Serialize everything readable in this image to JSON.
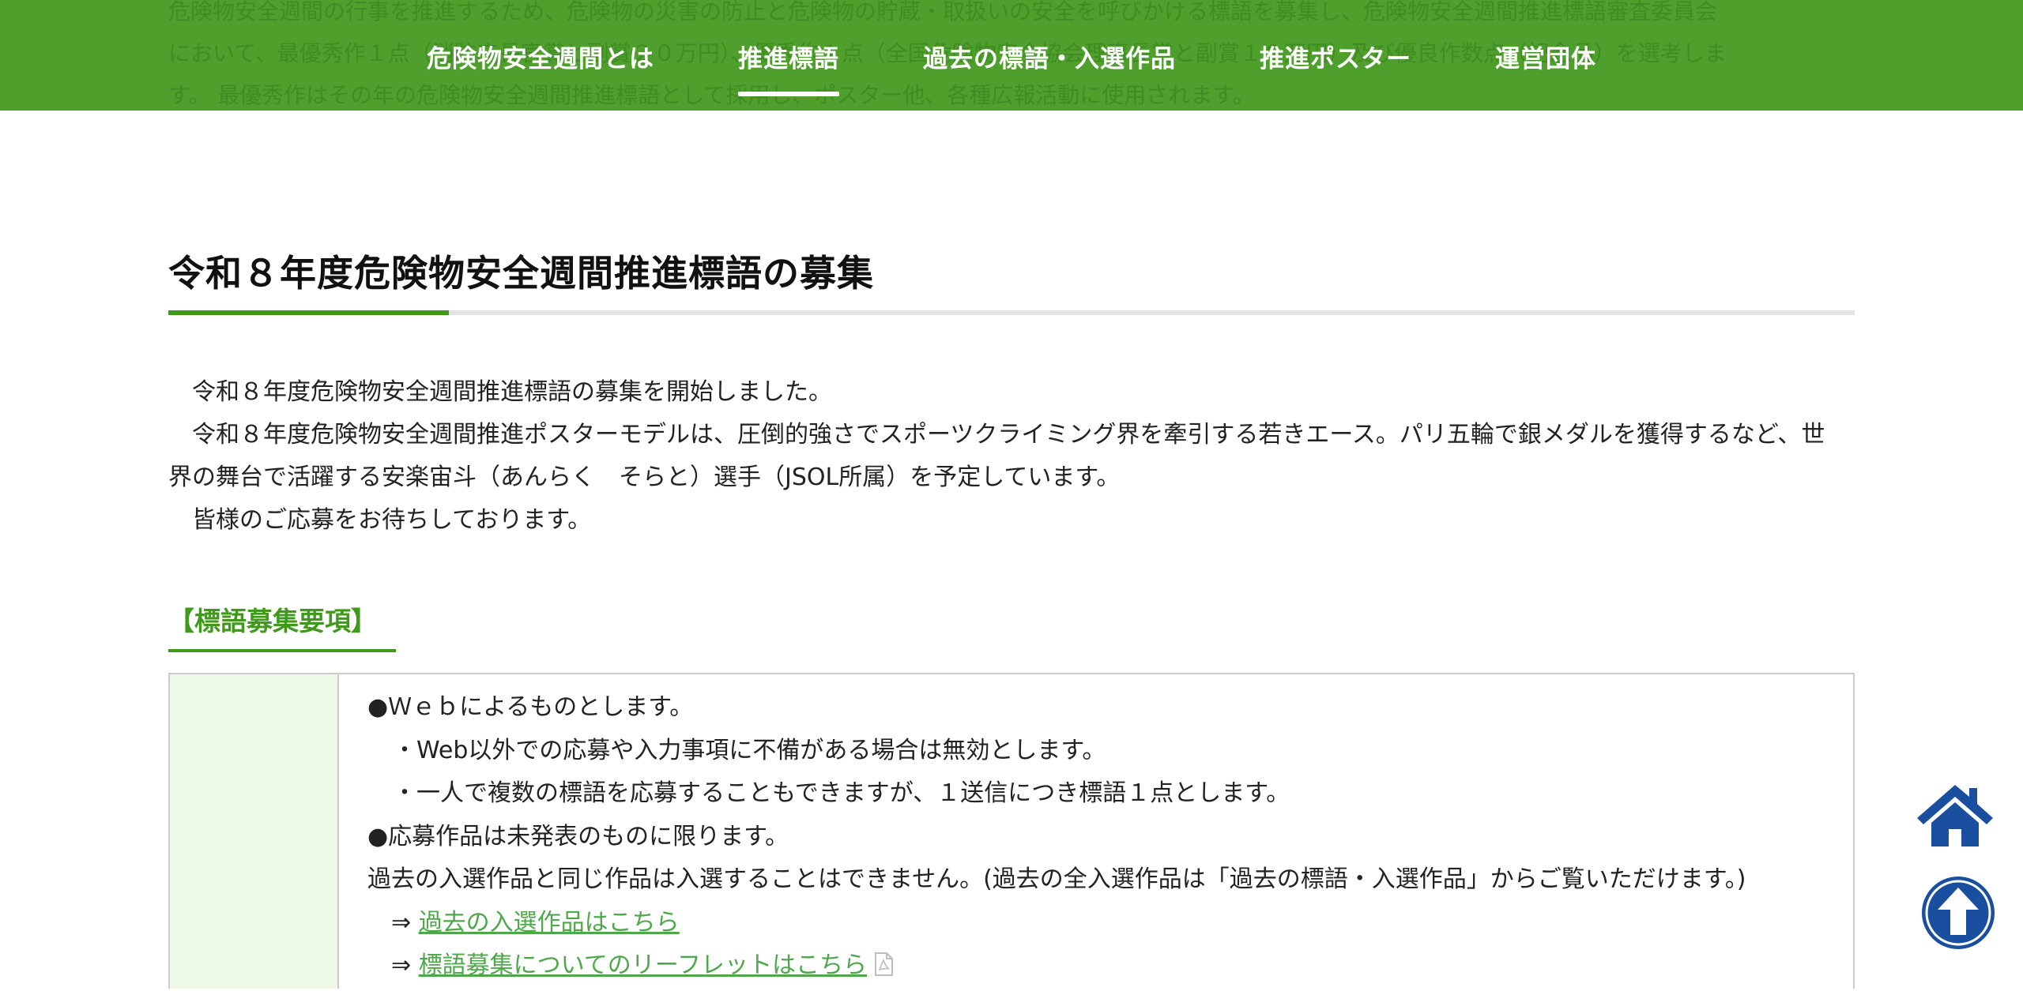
{
  "header": {
    "ghost_text": [
      "危険物安全週間の行事を推進するため、危険物の災害の防止と危険物の貯蔵・取扱いの安全を呼びかける標語を募集し、危険物安全週間推進標語審査委員会",
      "において、最優秀作１点（消防庁長官賞と副賞２０万円）、優秀作１点（全国危険物安全協会理事長賞と副賞１０万円）及び優良作数点（記念品）を選考しま",
      "す。 最優秀作はその年の危険物安全週間推進標語として採用し、ポスター他、各種広報活動に使用されます。"
    ],
    "nav": [
      {
        "label": "危険物安全週間とは",
        "active": false
      },
      {
        "label": "推進標語",
        "active": true
      },
      {
        "label": "過去の標語・入選作品",
        "active": false
      },
      {
        "label": "推進ポスター",
        "active": false
      },
      {
        "label": "運営団体",
        "active": false
      }
    ]
  },
  "main": {
    "title": "令和８年度危険物安全週間推進標語の募集",
    "intro": [
      "　令和８年度危険物安全週間推進標語の募集を開始しました。",
      "　令和８年度危険物安全週間推進ポスターモデルは、圧倒的強さでスポーツクライミング界を牽引する若きエース。パリ五輪で銀メダルを獲得するなど、世",
      "界の舞台で活躍する安楽宙斗（あんらく　そらと）選手（JSOL所属）を予定しています。",
      "　皆様のご応募をお待ちしております。"
    ],
    "section_heading": "【標語募集要項】",
    "requirements": {
      "line1": "●Ｗｅｂによるものとします。",
      "line2": "・Web以外での応募や入力事項に不備がある場合は無効とします。",
      "line3": "・一人で複数の標語を応募することもできますが、１送信につき標語１点とします。",
      "line4": "●応募作品は未発表のものに限ります。",
      "line5": "過去の入選作品と同じ作品は入選することはできません。(過去の全入選作品は「過去の標語・入選作品」からご覧いただけます。)",
      "arrow": "⇒",
      "link1": "過去の入選作品はこちら",
      "link2": "標語募集についてのリーフレットはこちら"
    }
  },
  "colors": {
    "header_bg": "#4f9f2d",
    "accent_green": "#3f9a1c",
    "link_green": "#4ea84b",
    "table_label_bg": "#eef9e8",
    "fab_blue": "#1a4fa0"
  },
  "icons": {
    "pdf": "pdf-icon",
    "home": "home-icon",
    "back_to_top": "arrow-up-circle-icon"
  }
}
